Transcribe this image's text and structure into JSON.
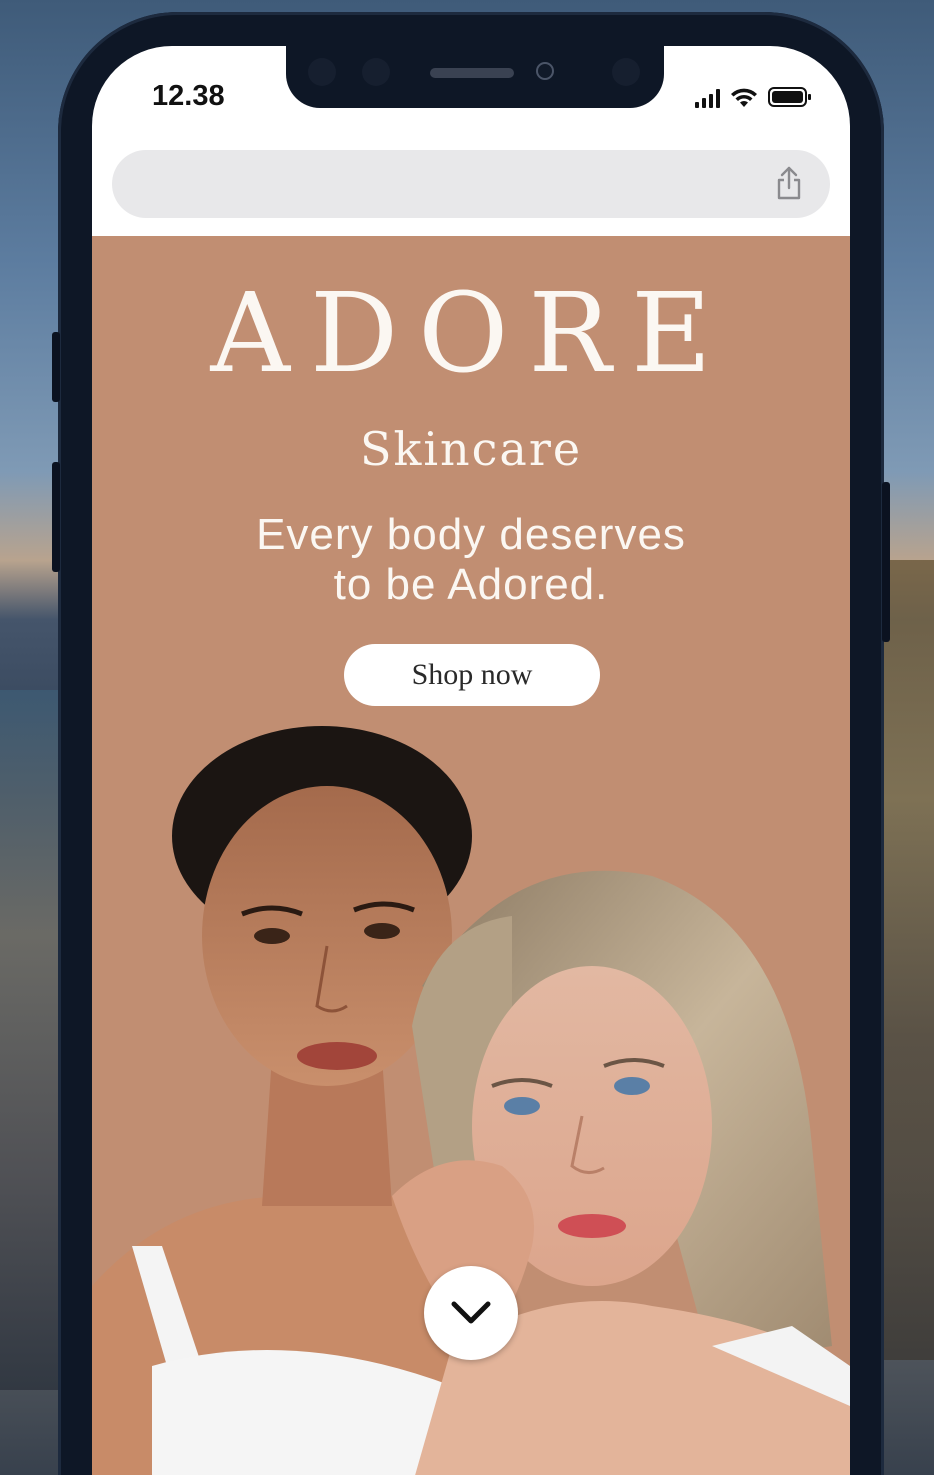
{
  "status_bar": {
    "time": "12.38"
  },
  "browser": {
    "share_icon": "share-icon"
  },
  "hero": {
    "brand": "ADORE",
    "subbrand": "Skincare",
    "tagline_line1": "Every body deserves",
    "tagline_line2": "to be Adored.",
    "cta_label": "Shop now",
    "scroll_icon": "chevron-down-icon",
    "background_color": "#c18e72"
  }
}
